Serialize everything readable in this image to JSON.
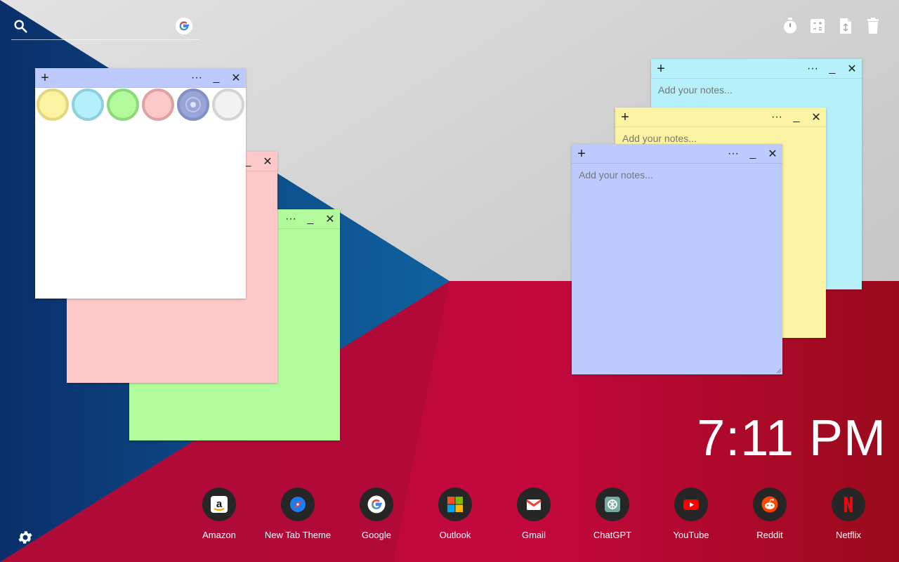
{
  "search": {
    "placeholder": "",
    "icon": "search-icon",
    "engine_icon": "google-icon"
  },
  "toolbar": [
    {
      "name": "timer-icon"
    },
    {
      "name": "calculator-icon"
    },
    {
      "name": "document-icon"
    },
    {
      "name": "trash-icon"
    }
  ],
  "notes": {
    "palette_note": {
      "color": "#ffffff",
      "header_color": "#bccafd",
      "add_label": "+",
      "more_label": "···",
      "min_label": "_",
      "close_label": "✕",
      "swatches": [
        {
          "name": "yellow",
          "color": "#fbf3a2"
        },
        {
          "name": "blue",
          "color": "#b4f0fb"
        },
        {
          "name": "green",
          "color": "#b2fb9c"
        },
        {
          "name": "pink",
          "color": "#fdc8c8"
        },
        {
          "name": "periwinkle",
          "color": "#9aa4d6",
          "selected": true
        },
        {
          "name": "white",
          "color": "#f2f2f2"
        }
      ]
    },
    "pink_note": {
      "color": "#fdc8c8",
      "more_label": "_",
      "close_label": "✕"
    },
    "green_note": {
      "color": "#b2fb9c",
      "more_label": "···",
      "min_label": "_",
      "close_label": "✕"
    },
    "blue_note": {
      "color": "#b5f0fb",
      "add_label": "+",
      "more_label": "···",
      "min_label": "_",
      "close_label": "✕",
      "text": "Add your notes..."
    },
    "yellow_note": {
      "color": "#fbf3a2",
      "add_label": "+",
      "more_label": "···",
      "min_label": "_",
      "close_label": "✕",
      "text": "Add your notes..."
    },
    "periwinkle_note": {
      "color": "#bccafd",
      "add_label": "+",
      "more_label": "···",
      "min_label": "_",
      "close_label": "✕",
      "text": "Add your notes..."
    }
  },
  "clock": {
    "time": "7:11 PM"
  },
  "dock": [
    {
      "label": "Amazon",
      "icon": "amazon-icon"
    },
    {
      "label": "New Tab Theme",
      "icon": "new-tab-theme-icon"
    },
    {
      "label": "Google",
      "icon": "google-icon"
    },
    {
      "label": "Outlook",
      "icon": "outlook-icon"
    },
    {
      "label": "Gmail",
      "icon": "gmail-icon"
    },
    {
      "label": "ChatGPT",
      "icon": "chatgpt-icon"
    },
    {
      "label": "YouTube",
      "icon": "youtube-icon"
    },
    {
      "label": "Reddit",
      "icon": "reddit-icon"
    },
    {
      "label": "Netflix",
      "icon": "netflix-icon"
    }
  ],
  "settings": {
    "icon": "gear-icon"
  }
}
